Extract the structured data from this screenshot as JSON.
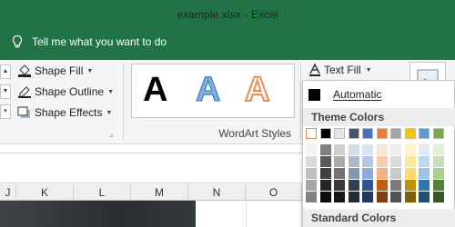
{
  "titlebar": {
    "title": "example.xlsx  -  Excel",
    "tell_me": "Tell me what you want to do",
    "bg": "#217346"
  },
  "ribbon": {
    "shape_styles": {
      "items": [
        {
          "label": "Shape Fill",
          "icon": "paint-bucket-icon"
        },
        {
          "label": "Shape Outline",
          "icon": "pen-outline-icon"
        },
        {
          "label": "Shape Effects",
          "icon": "shape-effects-icon"
        }
      ]
    },
    "wordart_styles": {
      "label": "WordArt Styles",
      "samples": [
        "A",
        "A",
        "A"
      ]
    },
    "text_fill": {
      "label": "Text Fill",
      "icon": "text-fill-icon"
    }
  },
  "columns": [
    "J",
    "K",
    "L",
    "M",
    "N",
    "O"
  ],
  "dropdown": {
    "automatic_label": "Automatic",
    "theme_colors_heading": "Theme Colors",
    "standard_colors_heading": "Standard Colors",
    "theme_top": [
      "#ffffff",
      "#000000",
      "#e7e6e6",
      "#44546a",
      "#4472c4",
      "#ed7d31",
      "#a5a5a5",
      "#ffc000",
      "#5b9bd5",
      "#70ad47"
    ],
    "theme_shades": [
      [
        "#f2f2f2",
        "#d9d9d9",
        "#bfbfbf",
        "#a6a6a6",
        "#808080"
      ],
      [
        "#7f7f7f",
        "#595959",
        "#404040",
        "#262626",
        "#0d0d0d"
      ],
      [
        "#d0cece",
        "#aeaaaa",
        "#757171",
        "#3b3838",
        "#171616"
      ],
      [
        "#d6dce4",
        "#adb9ca",
        "#8497b0",
        "#333f4f",
        "#222a35"
      ],
      [
        "#dae3f3",
        "#b4c7e7",
        "#8faadc",
        "#2f5597",
        "#203864"
      ],
      [
        "#fbe5d6",
        "#f8cbad",
        "#f4b183",
        "#c55a11",
        "#843c0c"
      ],
      [
        "#ededed",
        "#dbdbdb",
        "#c9c9c9",
        "#7b7b7b",
        "#525252"
      ],
      [
        "#fff2cc",
        "#ffe699",
        "#ffd966",
        "#bf9000",
        "#7f6000"
      ],
      [
        "#deebf7",
        "#bdd7ee",
        "#9dc3e6",
        "#2e75b6",
        "#1f4e79"
      ],
      [
        "#e2f0d9",
        "#c5e0b4",
        "#a9d18e",
        "#548235",
        "#385723"
      ]
    ]
  }
}
